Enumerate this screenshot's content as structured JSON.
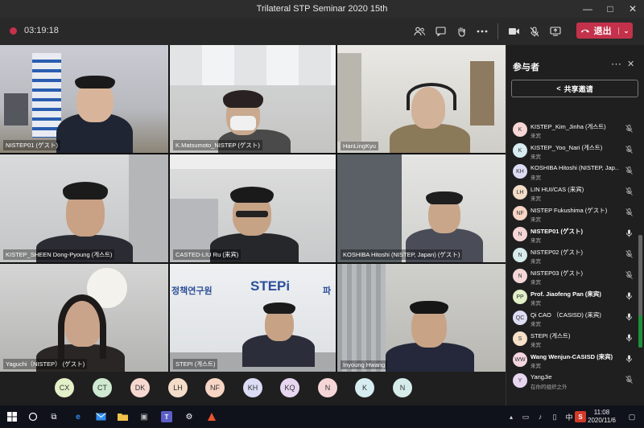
{
  "window": {
    "title": "Trilateral STP Seminar 2020 15th",
    "controls": [
      "—",
      "□",
      "✕"
    ]
  },
  "toolbar": {
    "timer": "03:19:18",
    "leave_label": "退出",
    "icons": [
      "participants-icon",
      "chat-icon",
      "raise-hand-icon",
      "more-icon",
      "camera-icon",
      "mic-off-icon",
      "share-screen-icon"
    ]
  },
  "tiles": [
    {
      "name": "NISTEP01 (ゲスト)"
    },
    {
      "name": "K.Matsumoto_NISTEP (ゲスト)"
    },
    {
      "name": "HanLingKyu"
    },
    {
      "name": "KISTEP_SHEEN Dong-Pyoung (게스트)"
    },
    {
      "name": "CASTED-LIU Ru (来宾)"
    },
    {
      "name": "KOSHIBA Hitoshi (NISTEP, Japan) (ゲスト)"
    },
    {
      "name": "Yaguchi（NISTEP） (ゲスト)"
    },
    {
      "name": "STEPI (게스트)"
    },
    {
      "name": "Inyoung Hwang"
    }
  ],
  "signage": {
    "stepi_logo": "STEPi",
    "korean_text": "정책연구원",
    "korean_right": "파"
  },
  "avatar_bar": [
    {
      "initials": "CX",
      "color": "#e3f0c8"
    },
    {
      "initials": "CT",
      "color": "#cfe8d0"
    },
    {
      "initials": "DK",
      "color": "#f7d8d0"
    },
    {
      "initials": "LH",
      "color": "#f3dcc8"
    },
    {
      "initials": "NF",
      "color": "#f7d5c4"
    },
    {
      "initials": "KH",
      "color": "#dcdcf4"
    },
    {
      "initials": "KQ",
      "color": "#e7d6f0"
    },
    {
      "initials": "N",
      "color": "#f5d6d6"
    },
    {
      "initials": "K",
      "color": "#d6ecf0"
    },
    {
      "initials": "N",
      "color": "#d6ecea"
    }
  ],
  "panel": {
    "title": "参与者",
    "share_label": "共享邀请",
    "participants": [
      {
        "initials": "K",
        "color": "#f7d6d6",
        "name": "KISTEP_Kim_Jinha (게스트)",
        "sub": "来宾",
        "bold": false,
        "mic": "muted"
      },
      {
        "initials": "K",
        "color": "#d6ecf0",
        "name": "KISTEP_Yoo_Nari (게스트)",
        "sub": "来宾",
        "bold": false,
        "mic": "muted"
      },
      {
        "initials": "KH",
        "color": "#dcdcf4",
        "name": "KOSHIBA Hitoshi (NISTEP, Jap...",
        "sub": "来宾",
        "bold": false,
        "mic": "muted"
      },
      {
        "initials": "LH",
        "color": "#f3dcc8",
        "name": "LIN HUI/CAS (来宾)",
        "sub": "来宾",
        "bold": false,
        "mic": "muted"
      },
      {
        "initials": "NF",
        "color": "#f7d5c4",
        "name": "NISTEP Fukushima (ゲスト)",
        "sub": "来宾",
        "bold": false,
        "mic": "muted"
      },
      {
        "initials": "N",
        "color": "#f5d6d6",
        "name": "NISTEP01 (ゲスト)",
        "sub": "来宾",
        "bold": true,
        "mic": "on"
      },
      {
        "initials": "N",
        "color": "#d6ecea",
        "name": "NISTEP02 (ゲスト)",
        "sub": "来宾",
        "bold": false,
        "mic": "muted"
      },
      {
        "initials": "N",
        "color": "#f5d6d6",
        "name": "NISTEP03 (ゲスト)",
        "sub": "来宾",
        "bold": false,
        "mic": "muted"
      },
      {
        "initials": "PP",
        "color": "#e3f0c8",
        "name": "Prof. Jiaofeng Pan (来宾)",
        "sub": "来宾",
        "bold": true,
        "mic": "on"
      },
      {
        "initials": "QC",
        "color": "#dcdcf4",
        "name": "Qi CAO （CASISD) (来宾)",
        "sub": "来宾",
        "bold": false,
        "mic": "on"
      },
      {
        "initials": "S",
        "color": "#f7e0c8",
        "name": "STEPI (게스트)",
        "sub": "来宾",
        "bold": false,
        "mic": "on"
      },
      {
        "initials": "WW",
        "color": "#f5d6e0",
        "name": "Wang Wenjun-CASISD (来宾)",
        "sub": "来宾",
        "bold": true,
        "mic": "on"
      },
      {
        "initials": "Y",
        "color": "#e7d6f0",
        "name": "YangJie",
        "sub": "在你的组织之外",
        "bold": false,
        "mic": "muted"
      }
    ]
  },
  "taskbar": {
    "time": "11:08",
    "date": "2020/11/6",
    "ime": "中"
  }
}
